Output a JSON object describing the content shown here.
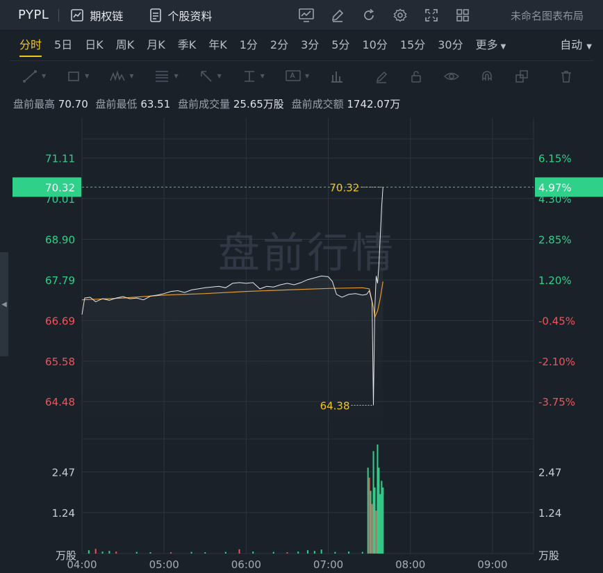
{
  "topbar": {
    "ticker": "PYPL",
    "options_chain": "期权链",
    "stock_profile": "个股资料",
    "layout_name": "未命名图表布局"
  },
  "timeframes": [
    "分时",
    "5日",
    "日K",
    "周K",
    "月K",
    "季K",
    "年K",
    "1分",
    "2分",
    "3分",
    "5分",
    "10分",
    "15分",
    "30分",
    "更多"
  ],
  "active_timeframe": "分时",
  "scale_mode": "自动",
  "premarket": {
    "high_label": "盘前最高",
    "high": "70.70",
    "low_label": "盘前最低",
    "low": "63.51",
    "volume_label": "盘前成交量",
    "volume": "25.65万股",
    "turnover_label": "盘前成交额",
    "turnover": "1742.07万"
  },
  "watermark": "盘前行情",
  "colors": {
    "up": "#2fd08a",
    "down": "#f0545b",
    "price_line": "#e6e8eb",
    "avg_line": "#e59b2e",
    "accent": "#f2c81e"
  },
  "chart_data": {
    "type": "line",
    "price_axis": {
      "ticks": [
        "71.11",
        "70.01",
        "68.90",
        "67.79",
        "66.69",
        "65.58",
        "64.48"
      ],
      "pct_ticks": [
        "6.15%",
        "4.30%",
        "2.85%",
        "1.20%",
        "-0.45%",
        "-2.10%",
        "-3.75%"
      ],
      "ylim": [
        63.5,
        72.2
      ]
    },
    "current_price": "70.32",
    "current_pct": "4.97%",
    "max_label": "70.32",
    "min_label": "64.38",
    "time_ticks": [
      "04:00",
      "05:00",
      "06:00",
      "07:00",
      "08:00",
      "09:00"
    ],
    "volume_axis": {
      "ticks": [
        "2.47",
        "1.24"
      ],
      "unit": "万股",
      "ylim": [
        0,
        3.3
      ]
    },
    "price": [
      [
        "04:00",
        66.85
      ],
      [
        "04:02",
        67.3
      ],
      [
        "04:06",
        67.32
      ],
      [
        "04:10",
        67.2
      ],
      [
        "04:15",
        67.28
      ],
      [
        "04:20",
        67.24
      ],
      [
        "04:25",
        67.3
      ],
      [
        "04:30",
        67.34
      ],
      [
        "04:35",
        67.28
      ],
      [
        "04:40",
        67.3
      ],
      [
        "04:45",
        67.25
      ],
      [
        "04:50",
        67.35
      ],
      [
        "04:55",
        67.38
      ],
      [
        "05:00",
        67.42
      ],
      [
        "05:05",
        67.48
      ],
      [
        "05:10",
        67.5
      ],
      [
        "05:15",
        67.45
      ],
      [
        "05:20",
        67.52
      ],
      [
        "05:25",
        67.55
      ],
      [
        "05:30",
        67.58
      ],
      [
        "05:35",
        67.6
      ],
      [
        "05:40",
        67.62
      ],
      [
        "05:45",
        67.58
      ],
      [
        "05:50",
        67.7
      ],
      [
        "05:55",
        67.72
      ],
      [
        "06:00",
        67.7
      ],
      [
        "06:05",
        67.72
      ],
      [
        "06:10",
        67.55
      ],
      [
        "06:15",
        67.62
      ],
      [
        "06:20",
        67.6
      ],
      [
        "06:25",
        67.66
      ],
      [
        "06:30",
        67.7
      ],
      [
        "06:35",
        67.66
      ],
      [
        "06:40",
        67.72
      ],
      [
        "06:45",
        67.8
      ],
      [
        "06:50",
        67.85
      ],
      [
        "06:55",
        67.9
      ],
      [
        "07:00",
        67.88
      ],
      [
        "07:03",
        67.75
      ],
      [
        "07:06",
        67.4
      ],
      [
        "07:10",
        67.32
      ],
      [
        "07:15",
        67.4
      ],
      [
        "07:20",
        67.42
      ],
      [
        "07:25",
        67.38
      ],
      [
        "07:28",
        67.4
      ],
      [
        "07:30",
        67.5
      ],
      [
        "07:32",
        67.2
      ],
      [
        "07:33",
        64.38
      ],
      [
        "07:34",
        67.0
      ],
      [
        "07:35",
        67.9
      ],
      [
        "07:36",
        67.7
      ],
      [
        "07:37",
        68.2
      ],
      [
        "07:38",
        69.0
      ],
      [
        "07:39",
        69.8
      ],
      [
        "07:40",
        70.32
      ]
    ],
    "avg_price": [
      [
        "04:00",
        67.25
      ],
      [
        "04:30",
        67.3
      ],
      [
        "05:00",
        67.38
      ],
      [
        "05:30",
        67.42
      ],
      [
        "06:00",
        67.48
      ],
      [
        "06:30",
        67.52
      ],
      [
        "07:00",
        67.56
      ],
      [
        "07:25",
        67.58
      ],
      [
        "07:30",
        67.55
      ],
      [
        "07:33",
        67.05
      ],
      [
        "07:34",
        66.78
      ],
      [
        "07:36",
        66.95
      ],
      [
        "07:38",
        67.3
      ],
      [
        "07:40",
        67.75
      ]
    ],
    "volume": [
      [
        "04:05",
        0.1,
        "up"
      ],
      [
        "04:10",
        0.14,
        "down"
      ],
      [
        "04:15",
        0.06,
        "up"
      ],
      [
        "04:20",
        0.08,
        "up"
      ],
      [
        "04:25",
        0.06,
        "down"
      ],
      [
        "04:40",
        0.05,
        "up"
      ],
      [
        "04:50",
        0.04,
        "up"
      ],
      [
        "05:05",
        0.04,
        "down"
      ],
      [
        "05:20",
        0.05,
        "up"
      ],
      [
        "05:30",
        0.04,
        "up"
      ],
      [
        "05:45",
        0.05,
        "up"
      ],
      [
        "05:55",
        0.13,
        "down"
      ],
      [
        "06:05",
        0.06,
        "up"
      ],
      [
        "06:20",
        0.05,
        "up"
      ],
      [
        "06:30",
        0.04,
        "down"
      ],
      [
        "06:38",
        0.06,
        "up"
      ],
      [
        "06:45",
        0.1,
        "up"
      ],
      [
        "06:50",
        0.08,
        "up"
      ],
      [
        "06:55",
        0.12,
        "up"
      ],
      [
        "07:05",
        0.05,
        "up"
      ],
      [
        "07:15",
        0.06,
        "up"
      ],
      [
        "07:25",
        0.05,
        "up"
      ],
      [
        "07:29",
        2.6,
        "up"
      ],
      [
        "07:30",
        2.3,
        "down"
      ],
      [
        "07:31",
        1.9,
        "up"
      ],
      [
        "07:32",
        1.5,
        "down"
      ],
      [
        "07:33",
        3.1,
        "up"
      ],
      [
        "07:34",
        2.0,
        "up"
      ],
      [
        "07:35",
        1.3,
        "down"
      ],
      [
        "07:36",
        3.3,
        "up"
      ],
      [
        "07:37",
        2.6,
        "up"
      ],
      [
        "07:38",
        1.8,
        "up"
      ],
      [
        "07:39",
        2.2,
        "up"
      ],
      [
        "07:40",
        2.0,
        "up"
      ]
    ]
  }
}
